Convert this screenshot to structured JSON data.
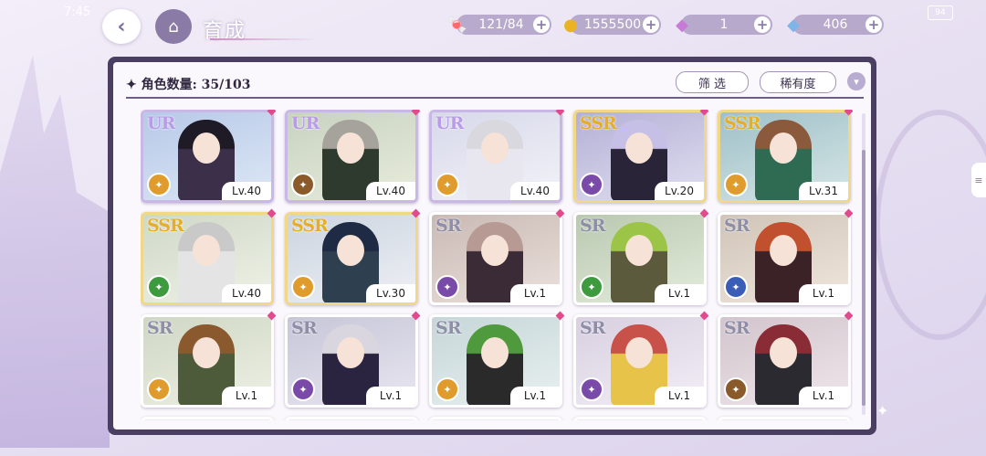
{
  "status": {
    "time": "7:45",
    "battery": "94"
  },
  "header": {
    "title": "育成",
    "resources": [
      {
        "id": "candy",
        "icon": "candy-icon",
        "glyph": "🍬",
        "value": "121/84"
      },
      {
        "id": "coin",
        "icon": "coin-icon",
        "glyph": "●",
        "value": "1555500"
      },
      {
        "id": "pink-gem",
        "icon": "pink-diamond-icon",
        "glyph": "◆",
        "value": "1"
      },
      {
        "id": "blue-gem",
        "icon": "blue-diamond-icon",
        "glyph": "◆",
        "value": "406"
      }
    ]
  },
  "panel": {
    "count_label": "角色数量: 35/103",
    "filter_label": "筛 选",
    "sort_label": "稀有度"
  },
  "cards": [
    {
      "rarity": "UR",
      "level": "Lv.40",
      "attr_color": "#e09b2d",
      "palette": [
        "#b7c9e8",
        "#dde7f5"
      ],
      "figure": "#3b2f4a",
      "hair": "#1e1a26"
    },
    {
      "rarity": "UR",
      "level": "Lv.40",
      "attr_color": "#8a5a2b",
      "palette": [
        "#c8d2c0",
        "#e8ecdc"
      ],
      "figure": "#2e3a2e",
      "hair": "#a5a39b"
    },
    {
      "rarity": "UR",
      "level": "Lv.40",
      "attr_color": "#e09b2d",
      "palette": [
        "#d7d9ea",
        "#f3f2f8"
      ],
      "figure": "#e8e6ef",
      "hair": "#d8d8de"
    },
    {
      "rarity": "SSR",
      "level": "Lv.20",
      "attr_color": "#7a4aa8",
      "palette": [
        "#b4b0d6",
        "#e0def0"
      ],
      "figure": "#2a2438",
      "hair": "#c6bfe6"
    },
    {
      "rarity": "SSR",
      "level": "Lv.31",
      "attr_color": "#e09b2d",
      "palette": [
        "#9ec0c8",
        "#d6e6e6"
      ],
      "figure": "#2f6b52",
      "hair": "#8b5a3c"
    },
    {
      "rarity": "SSR",
      "level": "Lv.40",
      "attr_color": "#3e9a3e",
      "palette": [
        "#cfd8c8",
        "#eef2e6"
      ],
      "figure": "#e4e4e4",
      "hair": "#c9c9c9"
    },
    {
      "rarity": "SSR",
      "level": "Lv.30",
      "attr_color": "#e09b2d",
      "palette": [
        "#cbd4e0",
        "#eef0f4"
      ],
      "figure": "#2e3f4f",
      "hair": "#1f2a44"
    },
    {
      "rarity": "SR",
      "level": "Lv.1",
      "attr_color": "#7a4aa8",
      "palette": [
        "#c9b9b4",
        "#ebe1dc"
      ],
      "figure": "#3a2b36",
      "hair": "#b89a94"
    },
    {
      "rarity": "SR",
      "level": "Lv.1",
      "attr_color": "#3e9a3e",
      "palette": [
        "#b9c8b0",
        "#e4ecdc"
      ],
      "figure": "#5b5a3c",
      "hair": "#9cc548"
    },
    {
      "rarity": "SR",
      "level": "Lv.1",
      "attr_color": "#3a5db8",
      "palette": [
        "#d0c4b8",
        "#f0e6dc"
      ],
      "figure": "#3a2226",
      "hair": "#c1512e"
    },
    {
      "rarity": "SR",
      "level": "Lv.1",
      "attr_color": "#e09b2d",
      "palette": [
        "#cfd7c4",
        "#edf0e4"
      ],
      "figure": "#4d5b3a",
      "hair": "#8a5a2e"
    },
    {
      "rarity": "SR",
      "level": "Lv.1",
      "attr_color": "#7a4aa8",
      "palette": [
        "#c7c6d8",
        "#e8e6f0"
      ],
      "figure": "#2b2440",
      "hair": "#d9d6df"
    },
    {
      "rarity": "SR",
      "level": "Lv.1",
      "attr_color": "#e09b2d",
      "palette": [
        "#c6d6d8",
        "#e8f0f0"
      ],
      "figure": "#2a2a2a",
      "hair": "#4f9a3c"
    },
    {
      "rarity": "SR",
      "level": "Lv.1",
      "attr_color": "#7a4aa8",
      "palette": [
        "#d8cfe0",
        "#f2eef6"
      ],
      "figure": "#e8c34a",
      "hair": "#c8524a"
    },
    {
      "rarity": "SR",
      "level": "Lv.1",
      "attr_color": "#8a5a2b",
      "palette": [
        "#d2c4cc",
        "#eee6ea"
      ],
      "figure": "#2a2a30",
      "hair": "#8a2c36"
    }
  ]
}
